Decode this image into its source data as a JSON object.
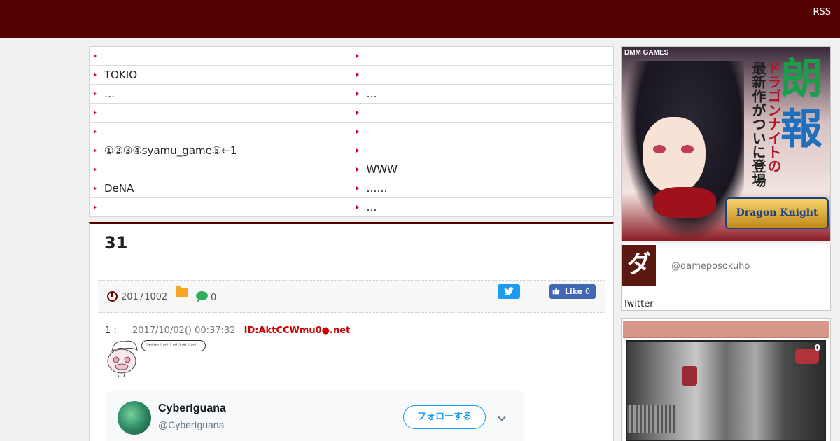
{
  "header": {
    "rss_label": "RSS"
  },
  "links_table": {
    "rows": [
      {
        "left": "",
        "right": ""
      },
      {
        "left": "TOKIO",
        "right": ""
      },
      {
        "left": "…",
        "right": "…"
      },
      {
        "left": "",
        "right": ""
      },
      {
        "left": "",
        "right": ""
      },
      {
        "left": "①②③④syamu_game⑤←1",
        "right": ""
      },
      {
        "left": "",
        "right": "WWW"
      },
      {
        "left": "DeNA",
        "right": "……"
      },
      {
        "left": "",
        "right": "…"
      }
    ]
  },
  "article": {
    "title": "31",
    "date": "20171002",
    "comment_count": "0",
    "tweet_button_icon": "twitter-bird-icon",
    "like_label": "Like",
    "like_count": "0",
    "post": {
      "number": "1 :",
      "timestamp": "2017/10/02() 00:37:32",
      "id": "ID:AktCCWmu0●.net",
      "ascii_art_bubble": "ｼｬｯｼｬｯ ｼｭｯ! ｼｭｯ! ｼｭｯ! ｼｭｯ!"
    },
    "embedded_tweet": {
      "name": "CyberIguana",
      "handle": "@CyberIguana",
      "follow_label": "フォローする"
    }
  },
  "sidebar": {
    "banner": {
      "brand": "DMM GAMES",
      "headline_1": "朗",
      "headline_2": "報",
      "vertical_red": "ドラゴンナイトの",
      "vertical_dark": "最新作がついに登場",
      "logo": "Dragon Knight"
    },
    "profile": {
      "icon_char": "ダ",
      "handle": "@dameposokuho",
      "twitter_label": "Twitter"
    },
    "feed": {
      "thumb_count": "0"
    }
  },
  "colors": {
    "header_bg": "#520000",
    "accent_red": "#d4002a",
    "id_red": "#cc0000",
    "twitter_blue": "#1d9bf0",
    "facebook_blue": "#4267b2",
    "side_head": "#d7978a"
  }
}
